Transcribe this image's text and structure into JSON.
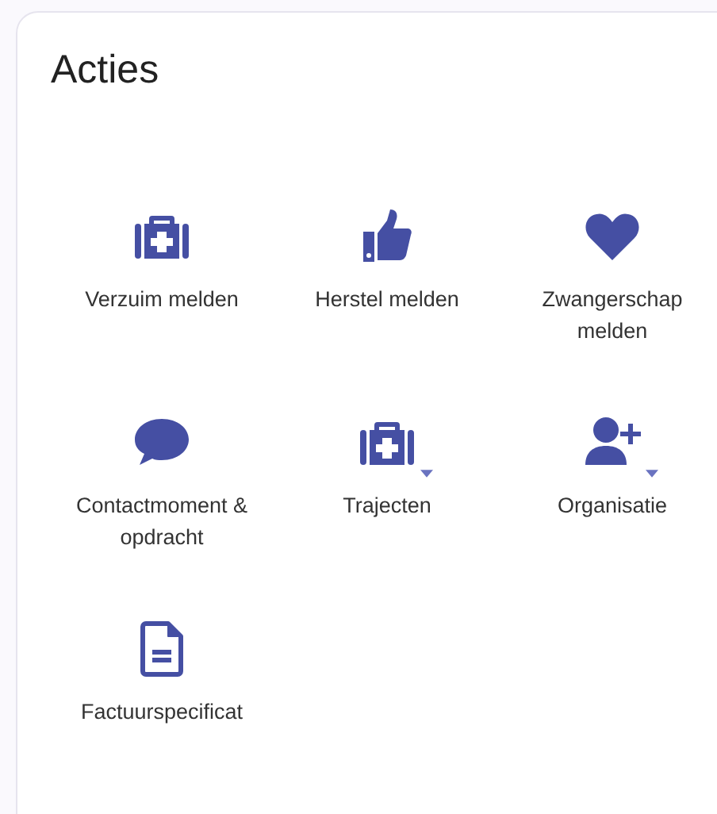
{
  "card": {
    "title": "Acties"
  },
  "actions": [
    {
      "kind": "medkit",
      "label": "Verzuim melden",
      "dropdown": false
    },
    {
      "kind": "thumb",
      "label": "Herstel melden",
      "dropdown": false
    },
    {
      "kind": "heart",
      "label": "Zwangerschap melden",
      "dropdown": false
    },
    {
      "kind": "chat",
      "label": "Contactmoment & opdracht",
      "dropdown": false
    },
    {
      "kind": "medkit",
      "label": "Trajecten",
      "dropdown": true
    },
    {
      "kind": "useradd",
      "label": "Organisatie",
      "dropdown": true
    },
    {
      "kind": "doc",
      "label": "Factuurspecificat",
      "dropdown": false
    }
  ]
}
